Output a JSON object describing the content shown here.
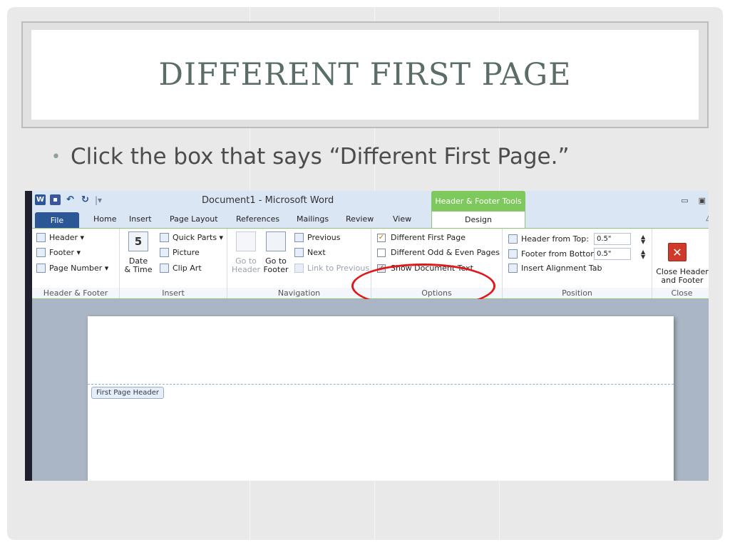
{
  "slide": {
    "title": "DIFFERENT FIRST PAGE",
    "bullet": "Click the box that says “Different First Page.”",
    "colors": {
      "title": "#5a6e66",
      "bullet": "#8aa39b",
      "background": "#e9e9e9"
    }
  },
  "word": {
    "window_title": "Document1 - Microsoft Word",
    "contextual_tab": "Header & Footer Tools",
    "tabs": [
      "File",
      "Home",
      "Insert",
      "Page Layout",
      "References",
      "Mailings",
      "Review",
      "View",
      "Design"
    ],
    "groups": {
      "header_footer": {
        "label": "Header & Footer",
        "items": [
          "Header ▾",
          "Footer ▾",
          "Page Number ▾"
        ]
      },
      "insert": {
        "label": "Insert",
        "date_time": "Date & Time",
        "date_line1": "Date",
        "date_line2": "& Time",
        "calendar_num": "5",
        "items": [
          "Quick Parts ▾",
          "Picture",
          "Clip Art"
        ]
      },
      "navigation": {
        "label": "Navigation",
        "goto_header_line1": "Go to",
        "goto_header_line2": "Header",
        "goto_footer_line1": "Go to",
        "goto_footer_line2": "Footer",
        "previous": "Previous",
        "next": "Next",
        "link_to_previous": "Link to Previous"
      },
      "options": {
        "label": "Options",
        "different_first_page": {
          "label": "Different First Page",
          "checked": true
        },
        "different_odd_even": {
          "label": "Different Odd & Even Pages",
          "checked": false
        },
        "show_document_text": {
          "label": "Show Document Text",
          "checked": true
        }
      },
      "position": {
        "label": "Position",
        "header_from_top_label": "Header from Top:",
        "header_from_top_value": "0.5\"",
        "footer_from_bottom_label": "Footer from Bottom:",
        "footer_from_bottom_value": "0.5\"",
        "insert_alignment_tab": "Insert Alignment Tab"
      },
      "close": {
        "label": "Close",
        "button_line1": "Close Header",
        "button_line2": "and Footer"
      }
    },
    "document": {
      "header_tag": "First Page Header"
    },
    "colors": {
      "contextual_tab": "#7dc95c",
      "file_tab": "#2b5797",
      "highlight": "#e0181a",
      "checkbox_check": "#d46a00"
    }
  }
}
